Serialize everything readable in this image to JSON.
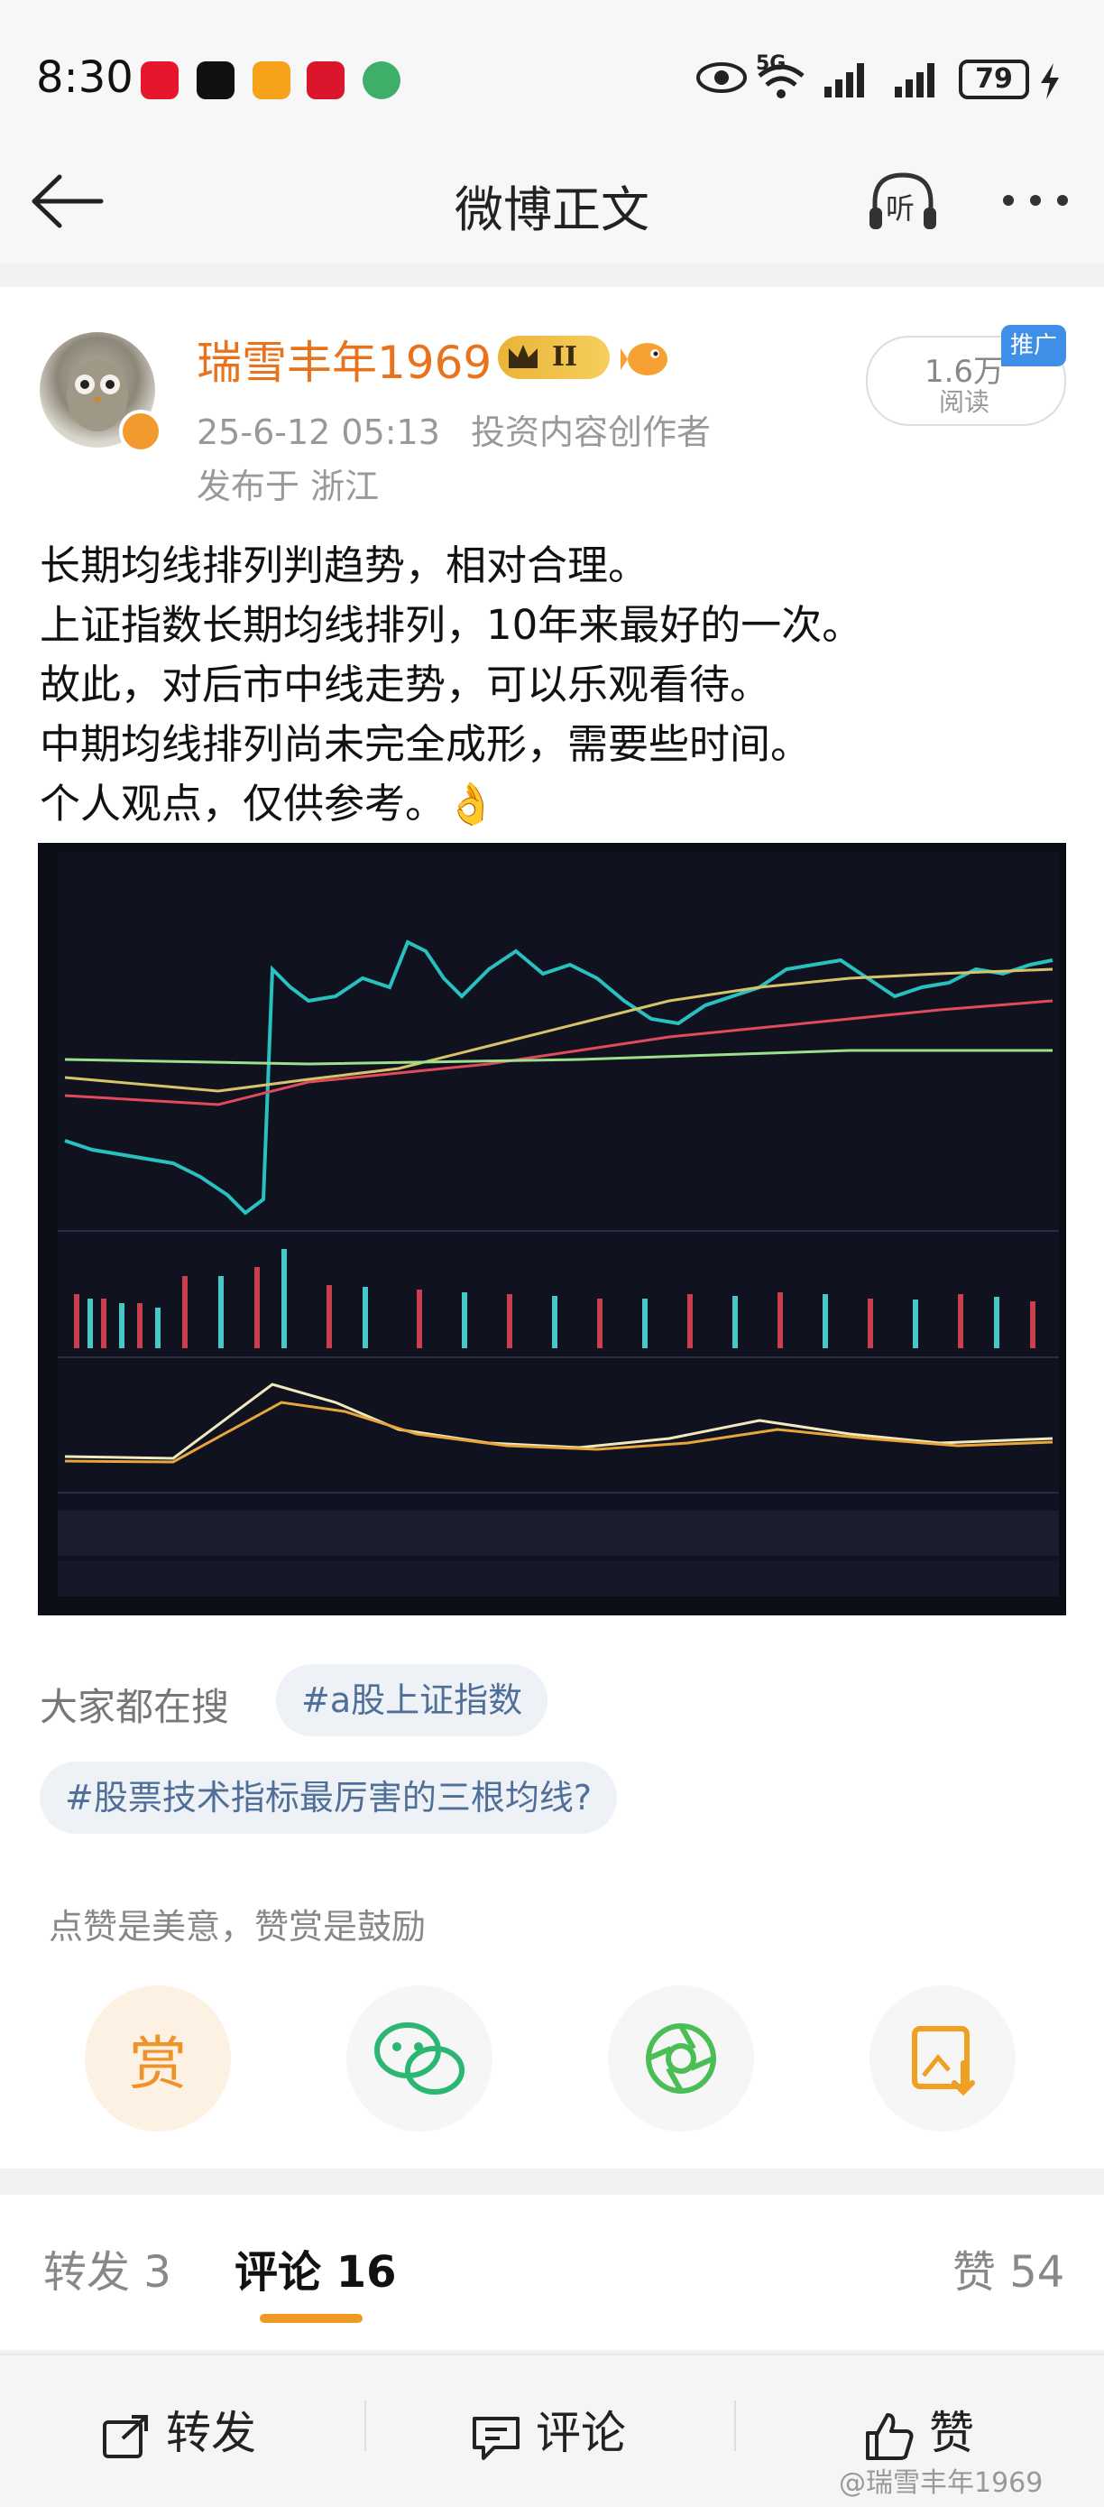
{
  "status_bar": {
    "time": "8:30",
    "signal": "5G",
    "battery": "79",
    "app_icons": [
      "weibo-icon",
      "tiktok-icon",
      "app-icon-orange",
      "app-icon-red",
      "app-icon-green"
    ]
  },
  "nav": {
    "title": "微博正文",
    "back_icon": "back-arrow-icon",
    "listen_label": "听",
    "more_icon": "more-icon"
  },
  "post": {
    "author": "瑞雪丰年1969",
    "level_badge": "II",
    "timestamp": "25-6-12 05:13",
    "author_tag": "投资内容创作者",
    "location": "发布于 浙江",
    "read_count": "1.6万",
    "read_label": "阅读",
    "promo_tag": "推广",
    "body_lines": [
      "长期均线排列判趋势，相对合理。",
      "上证指数长期均线排列，10年来最好的一次。",
      "故此，对后市中线走势，可以乐观看待。",
      "中期均线排列尚未完全成形，需要些时间。",
      "个人观点，仅供参考。👌"
    ]
  },
  "search": {
    "label": "大家都在搜",
    "hashtags": [
      "#a股上证指数",
      "#股票技术指标最厉害的三根均线?"
    ]
  },
  "reward_hint": "点赞是美意，赞赏是鼓励",
  "share_actions": [
    {
      "label": "赏",
      "icon": "reward-icon"
    },
    {
      "label": "",
      "icon": "wechat-icon"
    },
    {
      "label": "",
      "icon": "moments-icon"
    },
    {
      "label": "",
      "icon": "save-image-icon"
    }
  ],
  "tabs": {
    "repost": "转发 3",
    "comment": "评论 16",
    "like": "赞 54"
  },
  "bottom_bar": {
    "repost": "转发",
    "comment": "评论",
    "like": "赞"
  },
  "watermark": "@瑞雪丰年1969",
  "colors": {
    "accent_orange": "#e8731c",
    "tab_indicator": "#f09a25",
    "hashtag_text": "#4f6f99"
  }
}
